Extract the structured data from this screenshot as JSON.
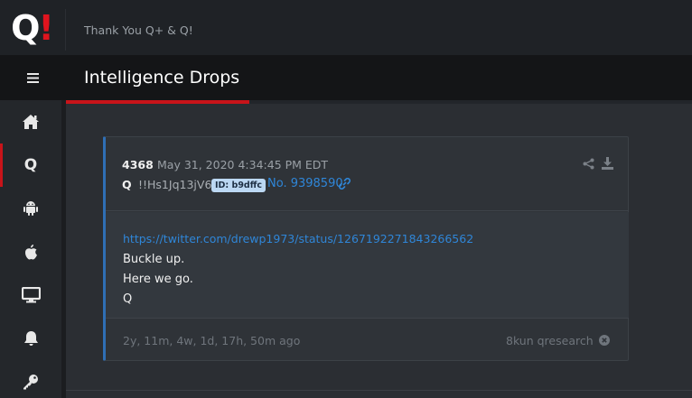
{
  "header": {
    "logo_letter": "Q",
    "logo_accent": "!",
    "subtitle": "Thank You Q+ & Q!"
  },
  "titlebar": {
    "title": "Intelligence Drops"
  },
  "sidebar": {
    "items": [
      {
        "icon": "home-icon",
        "active": false
      },
      {
        "icon": "q-icon",
        "label": "Q",
        "active": true
      },
      {
        "icon": "android-icon",
        "active": false
      },
      {
        "icon": "apple-icon",
        "active": false
      },
      {
        "icon": "desktop-icon",
        "active": false
      },
      {
        "icon": "bell-icon",
        "active": false
      },
      {
        "icon": "key-icon",
        "active": false
      }
    ]
  },
  "drop": {
    "number": "4368",
    "date": "May 31, 2020 4:34:45 PM EDT",
    "author": "Q",
    "tripcode": "!!Hs1Jq13jV6",
    "id_badge": "ID: b9dffc",
    "post_number": "No. 9398590",
    "link": "https://twitter.com/drewp1973/status/1267192271843266562",
    "lines": [
      "Buckle up.",
      "Here we go.",
      "Q"
    ],
    "ago": "2y, 11m, 4w, 1d, 17h, 50m ago",
    "source": "8kun qresearch"
  },
  "colors": {
    "accent_red": "#c8141a",
    "link_blue": "#2f86d8",
    "card_border_blue": "#2f6fb5"
  }
}
